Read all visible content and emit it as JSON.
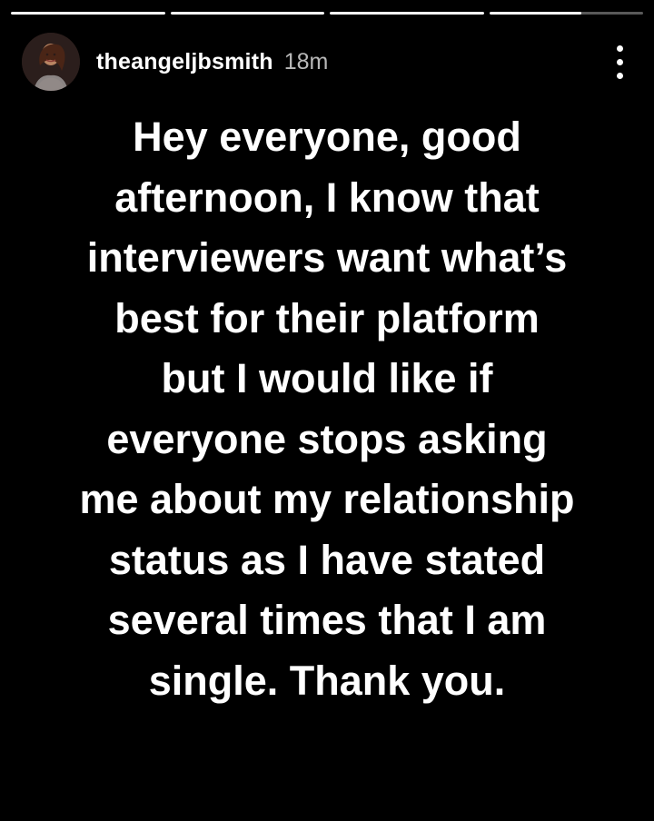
{
  "story": {
    "progress": [
      1,
      1,
      1,
      0.6
    ],
    "user": {
      "username": "theangeljbsmith",
      "time_ago": "18m"
    },
    "text_lines": [
      "Hey everyone, good",
      "afternoon, I know that",
      "interviewers want what’s",
      "best for their platform",
      "but I would like if",
      "everyone stops asking",
      "me about my relationship",
      "status as I have stated",
      "several times that I am",
      "single. Thank you."
    ]
  },
  "icons": {
    "more": "more-options-icon",
    "avatar": "profile-avatar"
  },
  "colors": {
    "background": "#000000",
    "text": "#ffffff",
    "progress_track": "rgba(255,255,255,0.35)"
  }
}
